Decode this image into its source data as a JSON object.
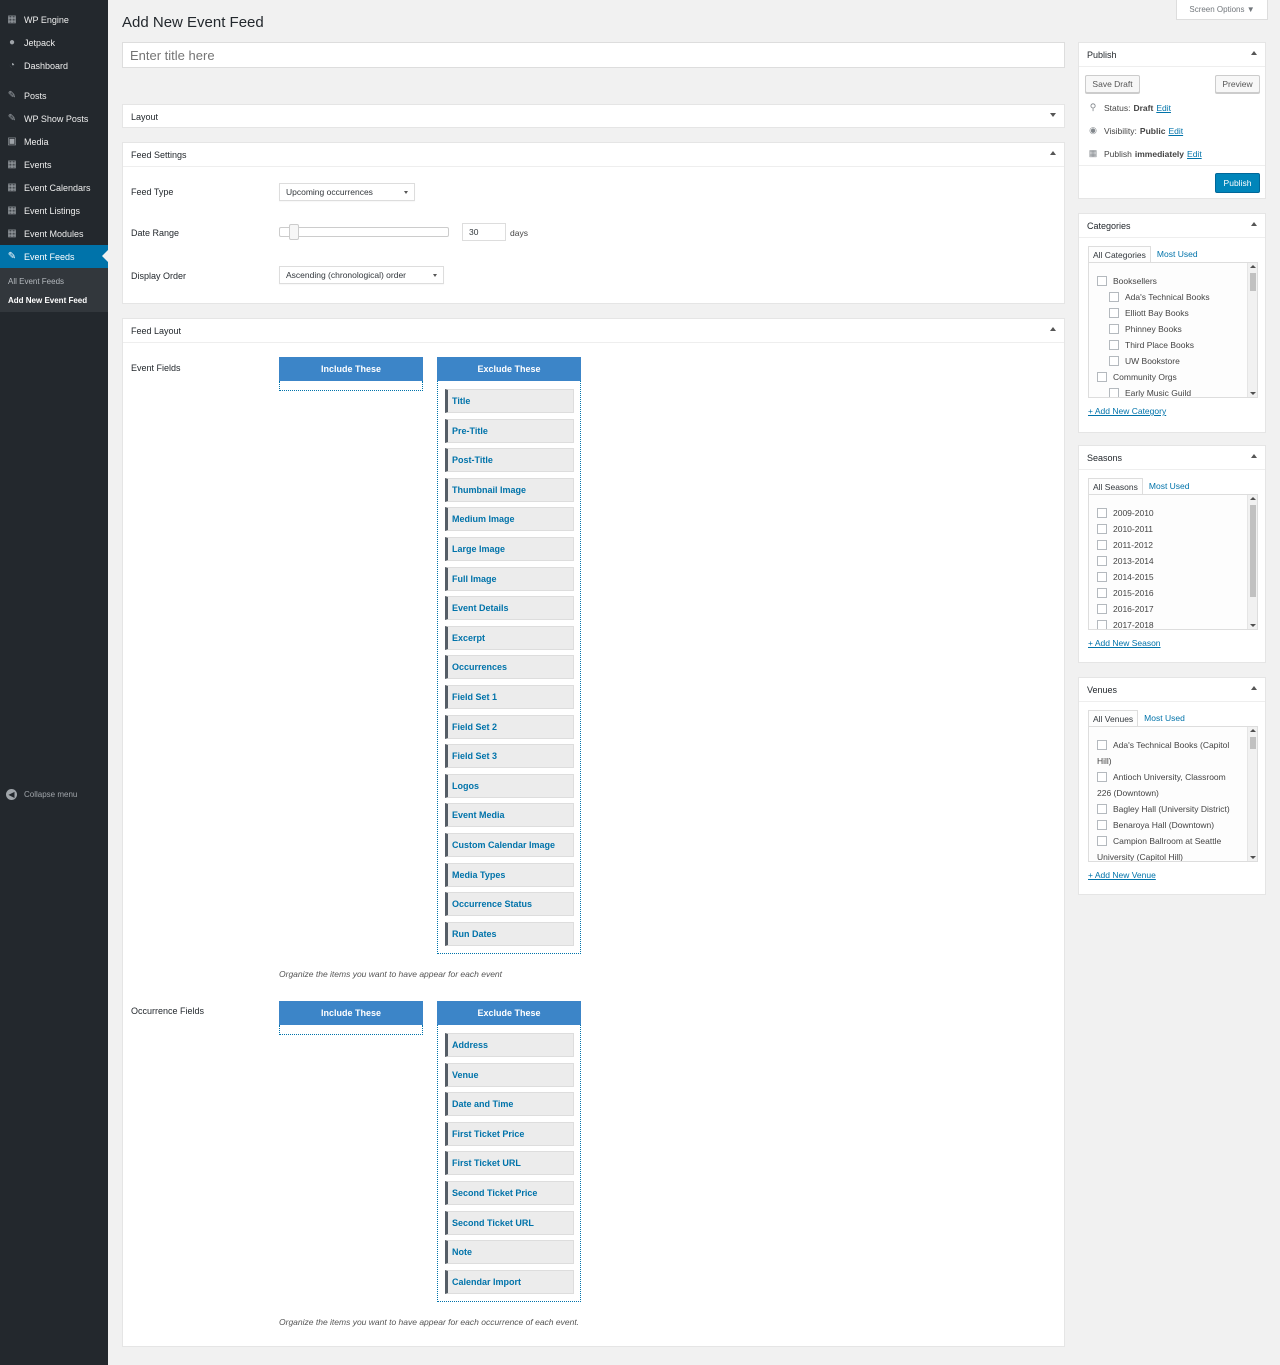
{
  "menu": {
    "items": [
      {
        "label": "WP Engine",
        "icon": "wp-engine-icon",
        "glyph": "▦"
      },
      {
        "label": "Jetpack",
        "icon": "jetpack-icon",
        "glyph": "●"
      },
      {
        "label": "Dashboard",
        "icon": "dashboard-icon",
        "glyph": "◔"
      },
      {
        "label": "Posts",
        "icon": "pin-icon",
        "glyph": "✎"
      },
      {
        "label": "WP Show Posts",
        "icon": "pin-icon",
        "glyph": "✎"
      },
      {
        "label": "Media",
        "icon": "media-icon",
        "glyph": "▣"
      },
      {
        "label": "Events",
        "icon": "calendar-icon",
        "glyph": "▦"
      },
      {
        "label": "Event Calendars",
        "icon": "calendar-icon",
        "glyph": "▦"
      },
      {
        "label": "Event Listings",
        "icon": "calendar-icon",
        "glyph": "▦"
      },
      {
        "label": "Event Modules",
        "icon": "calendar-icon",
        "glyph": "▦"
      },
      {
        "label": "Event Feeds",
        "icon": "pin-icon",
        "glyph": "✎"
      }
    ],
    "submenu": [
      "All Event Feeds",
      "Add New Event Feed"
    ],
    "collapse_label": "Collapse menu"
  },
  "header": {
    "title": "Add New Event Feed",
    "screen_options": "Screen Options ▼"
  },
  "title_input": {
    "placeholder": "Enter title here"
  },
  "layout_box": {
    "title": "Layout"
  },
  "feed_settings": {
    "title": "Feed Settings",
    "feed_type_label": "Feed Type",
    "feed_type_value": "Upcoming occurrences",
    "date_range_label": "Date Range",
    "date_range_value": "30",
    "date_range_unit": "days",
    "display_order_label": "Display Order",
    "display_order_value": "Ascending (chronological) order"
  },
  "feed_layout": {
    "title": "Feed Layout",
    "event_fields_label": "Event Fields",
    "occurrence_fields_label": "Occurrence Fields",
    "include_header": "Include These",
    "exclude_header": "Exclude These",
    "event_fields": [
      "Title",
      "Pre-Title",
      "Post-Title",
      "Thumbnail Image",
      "Medium Image",
      "Large Image",
      "Full Image",
      "Event Details",
      "Excerpt",
      "Occurrences",
      "Field Set 1",
      "Field Set 2",
      "Field Set 3",
      "Logos",
      "Event Media",
      "Custom Calendar Image",
      "Media Types",
      "Occurrence Status",
      "Run Dates"
    ],
    "event_help": "Organize the items you want to have appear for each event",
    "occurrence_fields": [
      "Address",
      "Venue",
      "Date and Time",
      "First Ticket Price",
      "First Ticket URL",
      "Second Ticket Price",
      "Second Ticket URL",
      "Note",
      "Calendar Import"
    ],
    "occurrence_help": "Organize the items you want to have appear for each occurrence of each event."
  },
  "publish": {
    "title": "Publish",
    "save_draft": "Save Draft",
    "preview": "Preview",
    "status_label": "Status:",
    "status_value": "Draft",
    "visibility_label": "Visibility:",
    "visibility_value": "Public",
    "publish_label": "Publish",
    "publish_value": "immediately",
    "edit": "Edit",
    "publish_button": "Publish"
  },
  "categories": {
    "title": "Categories",
    "tab_all": "All Categories",
    "tab_most": "Most Used",
    "items": [
      {
        "label": "Booksellers",
        "level": 0
      },
      {
        "label": "Ada's Technical Books",
        "level": 1
      },
      {
        "label": "Elliott Bay Books",
        "level": 1
      },
      {
        "label": "Phinney Books",
        "level": 1
      },
      {
        "label": "Third Place Books",
        "level": 1
      },
      {
        "label": "UW Bookstore",
        "level": 1
      },
      {
        "label": "Community Orgs",
        "level": 0
      },
      {
        "label": "Early Music Guild",
        "level": 1
      }
    ],
    "add_new": "+ Add New Category"
  },
  "seasons": {
    "title": "Seasons",
    "tab_all": "All Seasons",
    "tab_most": "Most Used",
    "items": [
      "2009-2010",
      "2010-2011",
      "2011-2012",
      "2013-2014",
      "2014-2015",
      "2015-2016",
      "2016-2017",
      "2017-2018"
    ],
    "add_new": "+ Add New Season"
  },
  "venues": {
    "title": "Venues",
    "tab_all": "All Venues",
    "tab_most": "Most Used",
    "items": [
      {
        "line1": "Ada's Technical Books (Capitol",
        "line2": "Hill)"
      },
      {
        "line1": "Antioch University, Classroom",
        "line2": "226 (Downtown)"
      },
      {
        "line1": "Bagley Hall (University District)",
        "line2": ""
      },
      {
        "line1": "Benaroya Hall (Downtown)",
        "line2": ""
      },
      {
        "line1": "Campion Ballroom at Seattle",
        "line2": "University (Capitol Hill)"
      }
    ],
    "add_new": "+ Add New Venue"
  },
  "colors": {
    "accent": "#0073aa",
    "sidebar": "#23282d",
    "column_header": "#3c85c8",
    "publish_button": "#0085ba"
  }
}
